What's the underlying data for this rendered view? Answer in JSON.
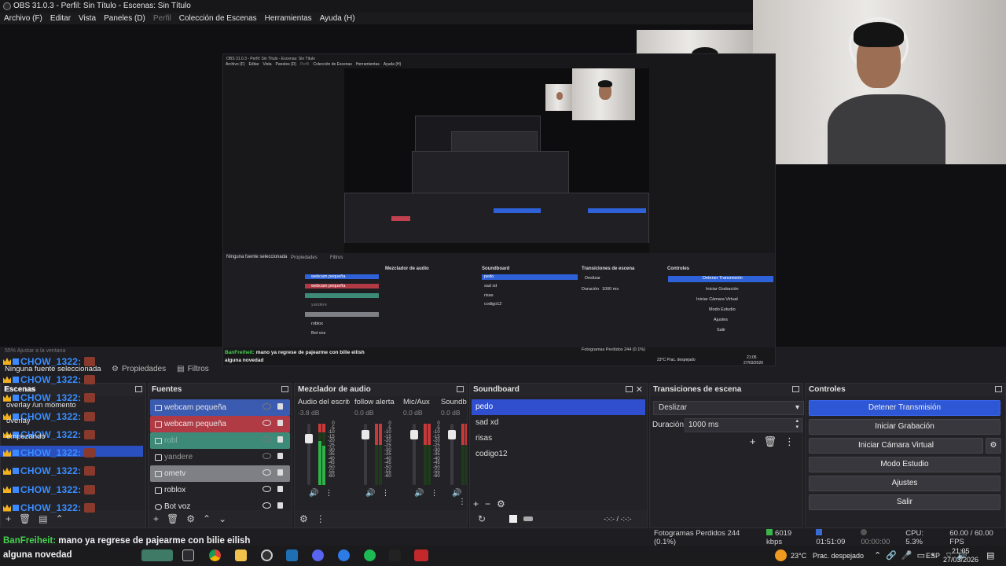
{
  "window": {
    "title": "OBS 31.0.3 - Perfil: Sin Título - Escenas: Sin Título"
  },
  "menu": [
    "Archivo (F)",
    "Editar",
    "Vista",
    "Paneles (D)",
    "Perfil",
    "Colección de Escenas",
    "Herramientas",
    "Ayuda (H)"
  ],
  "mini": {
    "title": "OBS 31.0.3 - Perfil: Sin Título - Escenas: Sin Título",
    "menu": [
      "Archivo (F)",
      "Editar",
      "Vista",
      "Paneles (D)",
      "Perfil",
      "Colección de Escenas",
      "Herramientas",
      "Ayuda (H)"
    ],
    "chat_user": "BanFreiheit:",
    "chat_text": "mano ya regrese de pajearme con bilie eilish",
    "chat_line2": "alguna novedad",
    "sources": [
      "webcam pequeña",
      "webcam pequeña",
      "yandere",
      "roblox",
      "Bot voz"
    ],
    "mixer_title": "Mezclador de audio",
    "sb_title": "Soundboard",
    "sb_items": [
      "pedo",
      "sad xd",
      "risas",
      "codigo12"
    ],
    "tr_title": "Transiciones de escena",
    "tr_value": "Deslizar",
    "tr_duration": "Duración",
    "tr_ms": "1000 ms",
    "ctl_title": "Controles",
    "ctl_buttons": [
      "Detener Transmisión",
      "Iniciar Grabación",
      "Iniciar Cámara Virtual",
      "Modo Estudio",
      "Ajustes",
      "Salir"
    ],
    "status": "Fotogramas Perdidos 244 (0.1%)",
    "no_source": "Ninguna fuente seleccionada",
    "props": "Propiedades",
    "filters": "Filtros",
    "clock": "21:05",
    "date": "27/03/2026",
    "weather": "23°C  Prac. despejado"
  },
  "zoom_label": "55%   Ajustar a la ventana",
  "chat": {
    "nick": "CHOW_1322:",
    "overlay_lines": [
      "Ninguna fuente seleccionada",
      "Escenas",
      "overlay /un momento",
      "overlay",
      "empezando"
    ],
    "user": "BanFreiheit:",
    "message": "mano ya regrese de pajearme con bilie eilish",
    "line2": "alguna novedad"
  },
  "tabs": {
    "properties": "Propiedades",
    "filters": "Filtros"
  },
  "panels": {
    "scenes": "Escenas",
    "sources": "Fuentes",
    "mixer": "Mezclador de audio",
    "soundboard": "Soundboard",
    "transitions": "Transiciones de escena",
    "controls": "Controles"
  },
  "sources": [
    {
      "name": "webcam pequeña",
      "style": "blue",
      "visible": false
    },
    {
      "name": "webcam pequeña",
      "style": "red",
      "visible": true
    },
    {
      "name": "robl",
      "style": "green",
      "visible": false
    },
    {
      "name": "yandere",
      "style": "none",
      "visible": false
    },
    {
      "name": "ometv",
      "style": "lightgrey",
      "visible": true
    },
    {
      "name": "roblox",
      "style": "none",
      "visible": true
    },
    {
      "name": "Bot voz",
      "style": "none",
      "visible": true
    }
  ],
  "mixer": [
    {
      "name": "Audio del escrito",
      "db": "-3.8 dB",
      "level": 0.72
    },
    {
      "name": "follow alerta",
      "db": "0.0 dB",
      "level": 0.0
    },
    {
      "name": "Mic/Aux",
      "db": "0.0 dB",
      "level": 0.0
    },
    {
      "name": "Soundb",
      "db": "0.0 dB",
      "level": 0.0
    }
  ],
  "meter_scale": [
    "0",
    "-5",
    "-10",
    "-15",
    "-20",
    "-25",
    "-30",
    "-35",
    "-40",
    "-45",
    "-50",
    "-55",
    "-60"
  ],
  "soundboard": {
    "items": [
      "pedo",
      "sad xd",
      "risas",
      "codigo12"
    ],
    "selected": 0,
    "time": "-:-:-  /  -:-:-"
  },
  "transitions": {
    "type": "Deslizar",
    "duration_label": "Duración",
    "duration_value": "1000 ms"
  },
  "controls": {
    "stream": "Detener Transmisión",
    "record": "Iniciar Grabación",
    "vcam": "Iniciar Cámara Virtual",
    "studio": "Modo Estudio",
    "settings": "Ajustes",
    "exit": "Salir"
  },
  "status": {
    "dropped": "Fotogramas Perdidos 244 (0.1%)",
    "bitrate": "6019 kbps",
    "stream_time": "01:51:09",
    "rec_time": "00:00:00",
    "cpu": "CPU: 5.3%",
    "fps": "60.00 / 60.00 FPS"
  },
  "taskbar": {
    "weather": "23°C",
    "weather_desc": "Prac. despejado",
    "lang": "ESP",
    "time": "21:05",
    "date": "27/03/2026"
  },
  "colors": {
    "accent": "#2e57d6",
    "green_meter": "#2fb24a",
    "chat_nick": "#3a8dff",
    "chat_user": "#47d14f"
  }
}
